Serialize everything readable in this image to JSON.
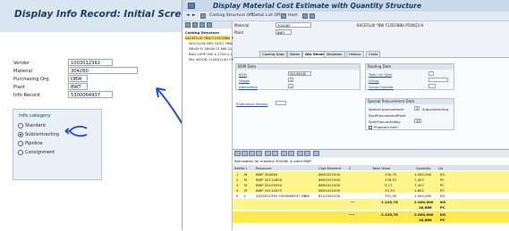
{
  "left": {
    "title": "Display Info Record: Initial Screen",
    "fields": [
      {
        "label": "Vendor",
        "value": "1003012392"
      },
      {
        "label": "Material",
        "value": "304260"
      },
      {
        "label": "Purchasing Org.",
        "value": "DBW"
      },
      {
        "label": "Plant",
        "value": "BWT"
      },
      {
        "label": "Info Record",
        "value": "5300064937"
      }
    ],
    "info_category": {
      "title": "Info category",
      "options": [
        "Standard",
        "Subcontracting",
        "Pipeline",
        "Consignment"
      ],
      "selected": "Subcontracting"
    }
  },
  "right": {
    "title": "Display Material Cost Estimate with Quantity Structure",
    "toolbar": {
      "costing_structure_off": "Costing Structure Off",
      "detail_list_off": "Detail List Off",
      "host": "Host"
    },
    "header": {
      "material_label": "Material",
      "material_value": "304260",
      "material_desc": "KACEFLUX *BW F135CNBH P540Q3 H",
      "plant_label": "Plant",
      "plant_value": "BWT"
    },
    "tree": {
      "header": "Costing Structure",
      "items": [
        "KACEFLUX *BW F135CNBH P",
        "NOCOLOK DRY DUST *BW",
        "DRUM FI 560X575 MM 22",
        "BAG LDPE 900 x 1700 x 1",
        "PAL WOOD 1140X1140 CP"
      ]
    },
    "tabs": [
      "Costing Data",
      "Dates",
      "Qty Struct.",
      "Valuation",
      "History",
      "Costs"
    ],
    "active_tab": "Qty Struct.",
    "bom_data": {
      "title": "BOM Data",
      "bom_label": "BOM",
      "bom_value": "00139435",
      "usage_label": "Usage",
      "usage_value": "1",
      "alternative_label": "Alternative",
      "alternative_value": "1"
    },
    "routing_data": {
      "title": "Routing Data",
      "task_list_type_label": "Task List Type",
      "group_label": "Group",
      "group_counter_label": "Group Counter"
    },
    "production_version_label": "Production Version",
    "special_procurement": {
      "title": "Special Procurement Data",
      "special_procurement_label": "Special procurement",
      "special_procurement_value": "3",
      "special_procurement_text": "Subcontracting",
      "spec_proc_plant_label": "SpclProcurementPlant",
      "spec_proc_key_label": "SpecProcurmntKey",
      "spec_proc_key_value": "33",
      "phantom_label": "Phantom item"
    },
    "itemization": {
      "caption": "Itemization for material 304260 in plant BWP",
      "columns": [
        "ItmNo",
        "I",
        "Resource",
        "Cost Element",
        "Σ",
        "Total Value",
        "Quantity",
        "Un"
      ],
      "rows": [
        [
          "1",
          "M",
          "BWP 304084",
          "",
          "6891021000",
          "",
          "139,75",
          "1.000,000",
          "KG"
        ],
        [
          "2",
          "M",
          "BWP 20114856",
          "",
          "6891021000",
          "",
          "178,51",
          "7,407",
          "PC"
        ],
        [
          "3",
          "M",
          "BWP 20105550",
          "",
          "6891021000",
          "",
          "5,17",
          "7,407",
          "PC"
        ],
        [
          "4",
          "M",
          "BWP 20114073",
          "",
          "6891021000",
          "",
          "15,33",
          "1,852",
          "PC"
        ],
        [
          "5",
          "L",
          "1003012392 5300064937 DBW",
          "",
          "6122000100",
          "",
          "791,00",
          "1.000,000",
          "KG"
        ]
      ],
      "subtotal": {
        "sigma": "••",
        "total": "1.125,76",
        "q1": "2.000,000",
        "u1": "KG",
        "q2": "16,666",
        "u2": "PC"
      },
      "grand_total": {
        "sigma": "•••",
        "total": "1.125,76",
        "q1": "2.000,000",
        "u1": "KG",
        "q2": "16,666",
        "u2": "PC"
      }
    }
  },
  "colors": {
    "highlight": "#fff58a",
    "total_highlight": "#ffe94d",
    "annotation": "#1f49d8",
    "sap_header": "#c9d9ea"
  }
}
